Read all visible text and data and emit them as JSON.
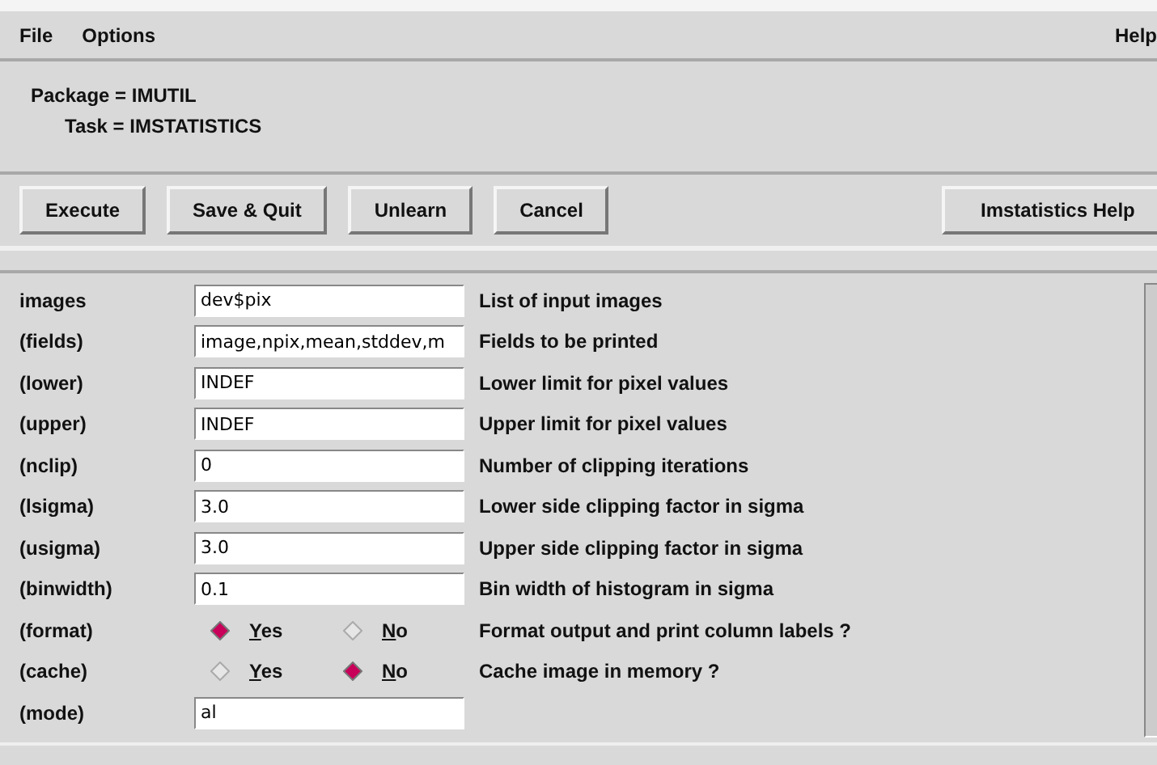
{
  "menu": {
    "left": [
      "File",
      "Options"
    ],
    "right": "Help"
  },
  "header": {
    "package": "Package = IMUTIL",
    "task": "Task = IMSTATISTICS"
  },
  "buttons": [
    "Execute",
    "Save & Quit",
    "Unlearn",
    "Cancel"
  ],
  "help_button": "Imstatistics Help",
  "params": [
    {
      "kind": "text",
      "name": "images",
      "value": "dev$pix",
      "description": "List of input images"
    },
    {
      "kind": "text",
      "name": "(fields)",
      "value": "image,npix,mean,stddev,m",
      "description": "Fields to be printed"
    },
    {
      "kind": "text",
      "name": "(lower)",
      "value": "INDEF",
      "description": "Lower limit for pixel values"
    },
    {
      "kind": "text",
      "name": "(upper)",
      "value": "INDEF",
      "description": "Upper limit for pixel values"
    },
    {
      "kind": "text",
      "name": "(nclip)",
      "value": "0",
      "description": "Number of clipping iterations"
    },
    {
      "kind": "text",
      "name": "(lsigma)",
      "value": "3.0",
      "description": "Lower side clipping factor in sigma"
    },
    {
      "kind": "text",
      "name": "(usigma)",
      "value": "3.0",
      "description": "Upper side clipping factor in sigma"
    },
    {
      "kind": "text",
      "name": "(binwidth)",
      "value": "0.1",
      "description": "Bin width of histogram in sigma"
    },
    {
      "kind": "radio",
      "name": "(format)",
      "options": [
        {
          "label": "Yes",
          "selected": true
        },
        {
          "label": "No",
          "selected": false
        }
      ],
      "description": "Format output and print column labels ?"
    },
    {
      "kind": "radio",
      "name": "(cache)",
      "options": [
        {
          "label": "Yes",
          "selected": false
        },
        {
          "label": "No",
          "selected": true
        }
      ],
      "description": "Cache image in memory ?"
    },
    {
      "kind": "text",
      "name": "(mode)",
      "value": "al"
    }
  ]
}
